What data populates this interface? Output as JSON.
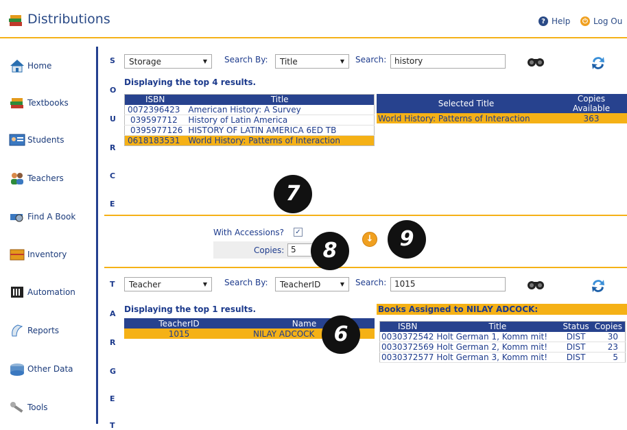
{
  "header": {
    "title": "Distributions",
    "help": "Help",
    "logout": "Log Ou"
  },
  "sidebar": {
    "items": [
      {
        "label": "Home",
        "icon": "home-icon"
      },
      {
        "label": "Textbooks",
        "icon": "textbooks-icon"
      },
      {
        "label": "Students",
        "icon": "students-icon"
      },
      {
        "label": "Teachers",
        "icon": "teachers-icon"
      },
      {
        "label": "Find A Book",
        "icon": "find-book-icon"
      },
      {
        "label": "Inventory",
        "icon": "inventory-icon"
      },
      {
        "label": "Automation",
        "icon": "automation-icon"
      },
      {
        "label": "Reports",
        "icon": "reports-icon"
      },
      {
        "label": "Other Data",
        "icon": "other-data-icon"
      },
      {
        "label": "Tools",
        "icon": "tools-icon"
      }
    ]
  },
  "source": {
    "letters": [
      "S",
      "O",
      "U",
      "R",
      "C",
      "E"
    ],
    "type_select": "Storage",
    "search_by_label": "Search By:",
    "search_by_select": "Title",
    "search_label": "Search:",
    "search_value": "history",
    "display_text": "Displaying the top 4 results.",
    "columns": [
      "ISBN",
      "Title"
    ],
    "rows": [
      {
        "isbn": "0072396423",
        "title": "American History: A Survey"
      },
      {
        "isbn": "039597712",
        "title": "History of Latin America"
      },
      {
        "isbn": "0395977126",
        "title": "HISTORY OF LATIN AMERICA 6ED TB"
      },
      {
        "isbn": "0618183531",
        "title": "World History: Patterns of Interaction"
      }
    ],
    "selected_columns": [
      "Selected Title",
      "Copies Available"
    ],
    "selected_title": "World History: Patterns of Interaction",
    "selected_copies": "363"
  },
  "middle": {
    "with_accessions_label": "With Accessions?",
    "with_accessions_checked": "✓",
    "copies_label": "Copies:",
    "copies_value": "5"
  },
  "target": {
    "letters": [
      "T",
      "A",
      "R",
      "G",
      "E",
      "T"
    ],
    "type_select": "Teacher",
    "search_by_label": "Search By:",
    "search_by_select": "TeacherID",
    "search_label": "Search:",
    "search_value": "1015",
    "display_text": "Displaying the top 1 results.",
    "columns": [
      "TeacherID",
      "Name"
    ],
    "rows": [
      {
        "id": "1015",
        "name": "NILAY ADCOCK"
      }
    ],
    "books_header": "Books Assigned to NILAY ADCOCK:",
    "books_columns": [
      "ISBN",
      "Title",
      "Status",
      "Copies"
    ],
    "books": [
      {
        "isbn": "0030372542",
        "title": "Holt German 1, Komm mit!",
        "status": "DIST",
        "copies": "30"
      },
      {
        "isbn": "0030372569",
        "title": "Holt German 2, Komm mit!",
        "status": "DIST",
        "copies": "23"
      },
      {
        "isbn": "0030372577",
        "title": "Holt German 3, Komm mit!",
        "status": "DIST",
        "copies": "5"
      }
    ]
  },
  "badges": {
    "b6": "6",
    "b7": "7",
    "b8": "8",
    "b9": "9"
  },
  "colors": {
    "accent": "#f5b116",
    "navy": "#27428e"
  }
}
